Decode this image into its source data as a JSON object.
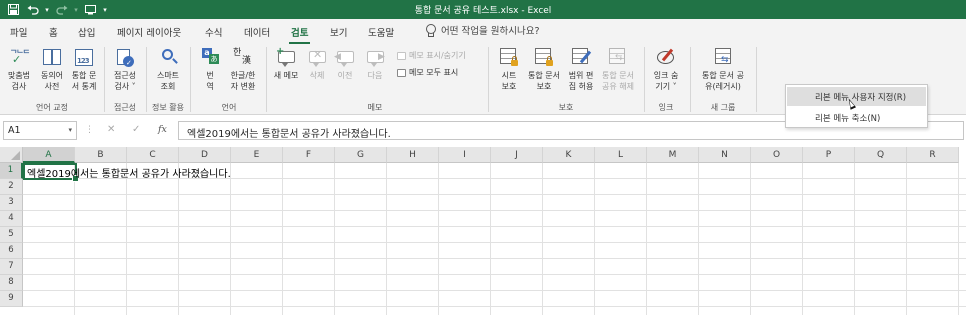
{
  "titlebar": {
    "title": "통합 문서 공유 테스트.xlsx  -  Excel",
    "qat": {
      "save_icon": "save-icon",
      "undo_icon": "undo-icon",
      "redo_icon": "redo-icon",
      "extra_icon": "screen-icon",
      "customize_icon": "chevron-down-icon"
    },
    "color": "#217346"
  },
  "tabs": [
    "파일",
    "홈",
    "삽입",
    "페이지 레이아웃",
    "수식",
    "데이터",
    "검토",
    "보기",
    "도움말"
  ],
  "active_tab": "검토",
  "tell_me": "어떤 작업을 원하시나요?",
  "ribbon": {
    "groups": {
      "proofing": "언어 교정",
      "accessibility": "접근성",
      "insights": "정보 활용",
      "language": "언어",
      "comments": "메모",
      "protect": "보호",
      "ink": "잉크",
      "new_group": "새 그룹"
    },
    "buttons": {
      "spelling": [
        "맞춤법",
        "검사"
      ],
      "thesaurus": [
        "동의어",
        "사전"
      ],
      "workbook_stats": [
        "통합 문",
        "서 통계"
      ],
      "check_accessibility": [
        "접근성",
        "검사 ˅"
      ],
      "smart_lookup": [
        "스마트",
        "조회"
      ],
      "translate": [
        "번",
        "역"
      ],
      "hanja": [
        "한글/한",
        "자 변환"
      ],
      "new_comment": [
        "새 메모"
      ],
      "delete": [
        "삭제"
      ],
      "previous": [
        "이전"
      ],
      "next": [
        "다음"
      ],
      "show_hide_comment": "메모 표시/숨기기",
      "show_all_comments": "메모 모두 표시",
      "protect_sheet": [
        "시트",
        "보호"
      ],
      "protect_workbook": [
        "통합 문서",
        "보호"
      ],
      "allow_edit_ranges": [
        "범위 편",
        "집 허용"
      ],
      "unshare_workbook": [
        "통합 문서",
        "공유 해제"
      ],
      "hide_ink": [
        "잉크 숨",
        "기기 ˅"
      ],
      "share_workbook_legacy": [
        "통합 문서 공",
        "유(레거시)"
      ]
    }
  },
  "formula_bar": {
    "name_box": "A1",
    "fx": "fx",
    "value": "엑셀2019에서는 통합문서 공유가 사라졌습니다."
  },
  "grid": {
    "columns": [
      "A",
      "B",
      "C",
      "D",
      "E",
      "F",
      "G",
      "H",
      "I",
      "J",
      "K",
      "L",
      "M",
      "N",
      "O",
      "P",
      "Q",
      "R"
    ],
    "rows": [
      "1",
      "2",
      "3",
      "4",
      "5",
      "6",
      "7",
      "8",
      "9"
    ],
    "active_cell": "A1",
    "cell_a1": "엑셀2019에서는 통합문서 공유가 사라졌습니다."
  },
  "context_menu": {
    "items": [
      "리본 메뉴 사용자 지정(R)",
      "리본 메뉴 축소(N)"
    ],
    "hover_index": 0
  }
}
